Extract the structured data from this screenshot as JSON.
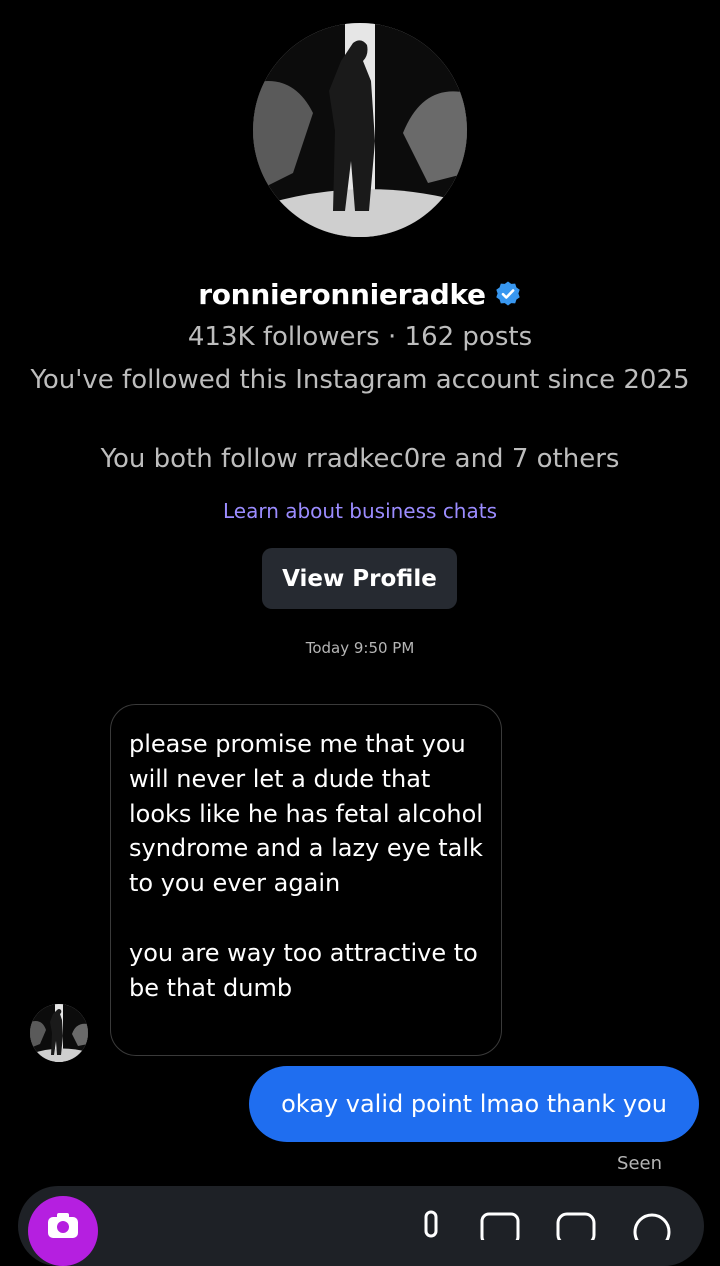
{
  "profile": {
    "username": "ronnieronnieradke",
    "verified": true,
    "stats": "413K followers · 162 posts",
    "follow_since": "You've followed this Instagram account since 2025",
    "mutual": "You both follow rradkec0re and 7 others",
    "learn_link": "Learn about business chats",
    "view_profile_label": "View Profile"
  },
  "conversation": {
    "timestamp": "Today 9:50 PM",
    "messages": [
      {
        "direction": "incoming",
        "text": "please promise me that you will never let a dude that looks like he has fetal alcohol syndrome and a lazy eye talk to you ever again\n\nyou are way too attractive to be that dumb"
      },
      {
        "direction": "outgoing",
        "text": "okay valid point lmao thank you"
      }
    ],
    "seen_label": "Seen"
  },
  "composer": {
    "icons": [
      "camera-icon",
      "microphone-icon",
      "gallery-icon",
      "sticker-icon",
      "add-icon"
    ]
  },
  "colors": {
    "background": "#000000",
    "outgoing_bubble": "#1f6ef0",
    "link": "#9b8cff",
    "verified_badge": "#3897f0",
    "camera_button": "#b51fe0",
    "button_bg": "#262a31"
  }
}
